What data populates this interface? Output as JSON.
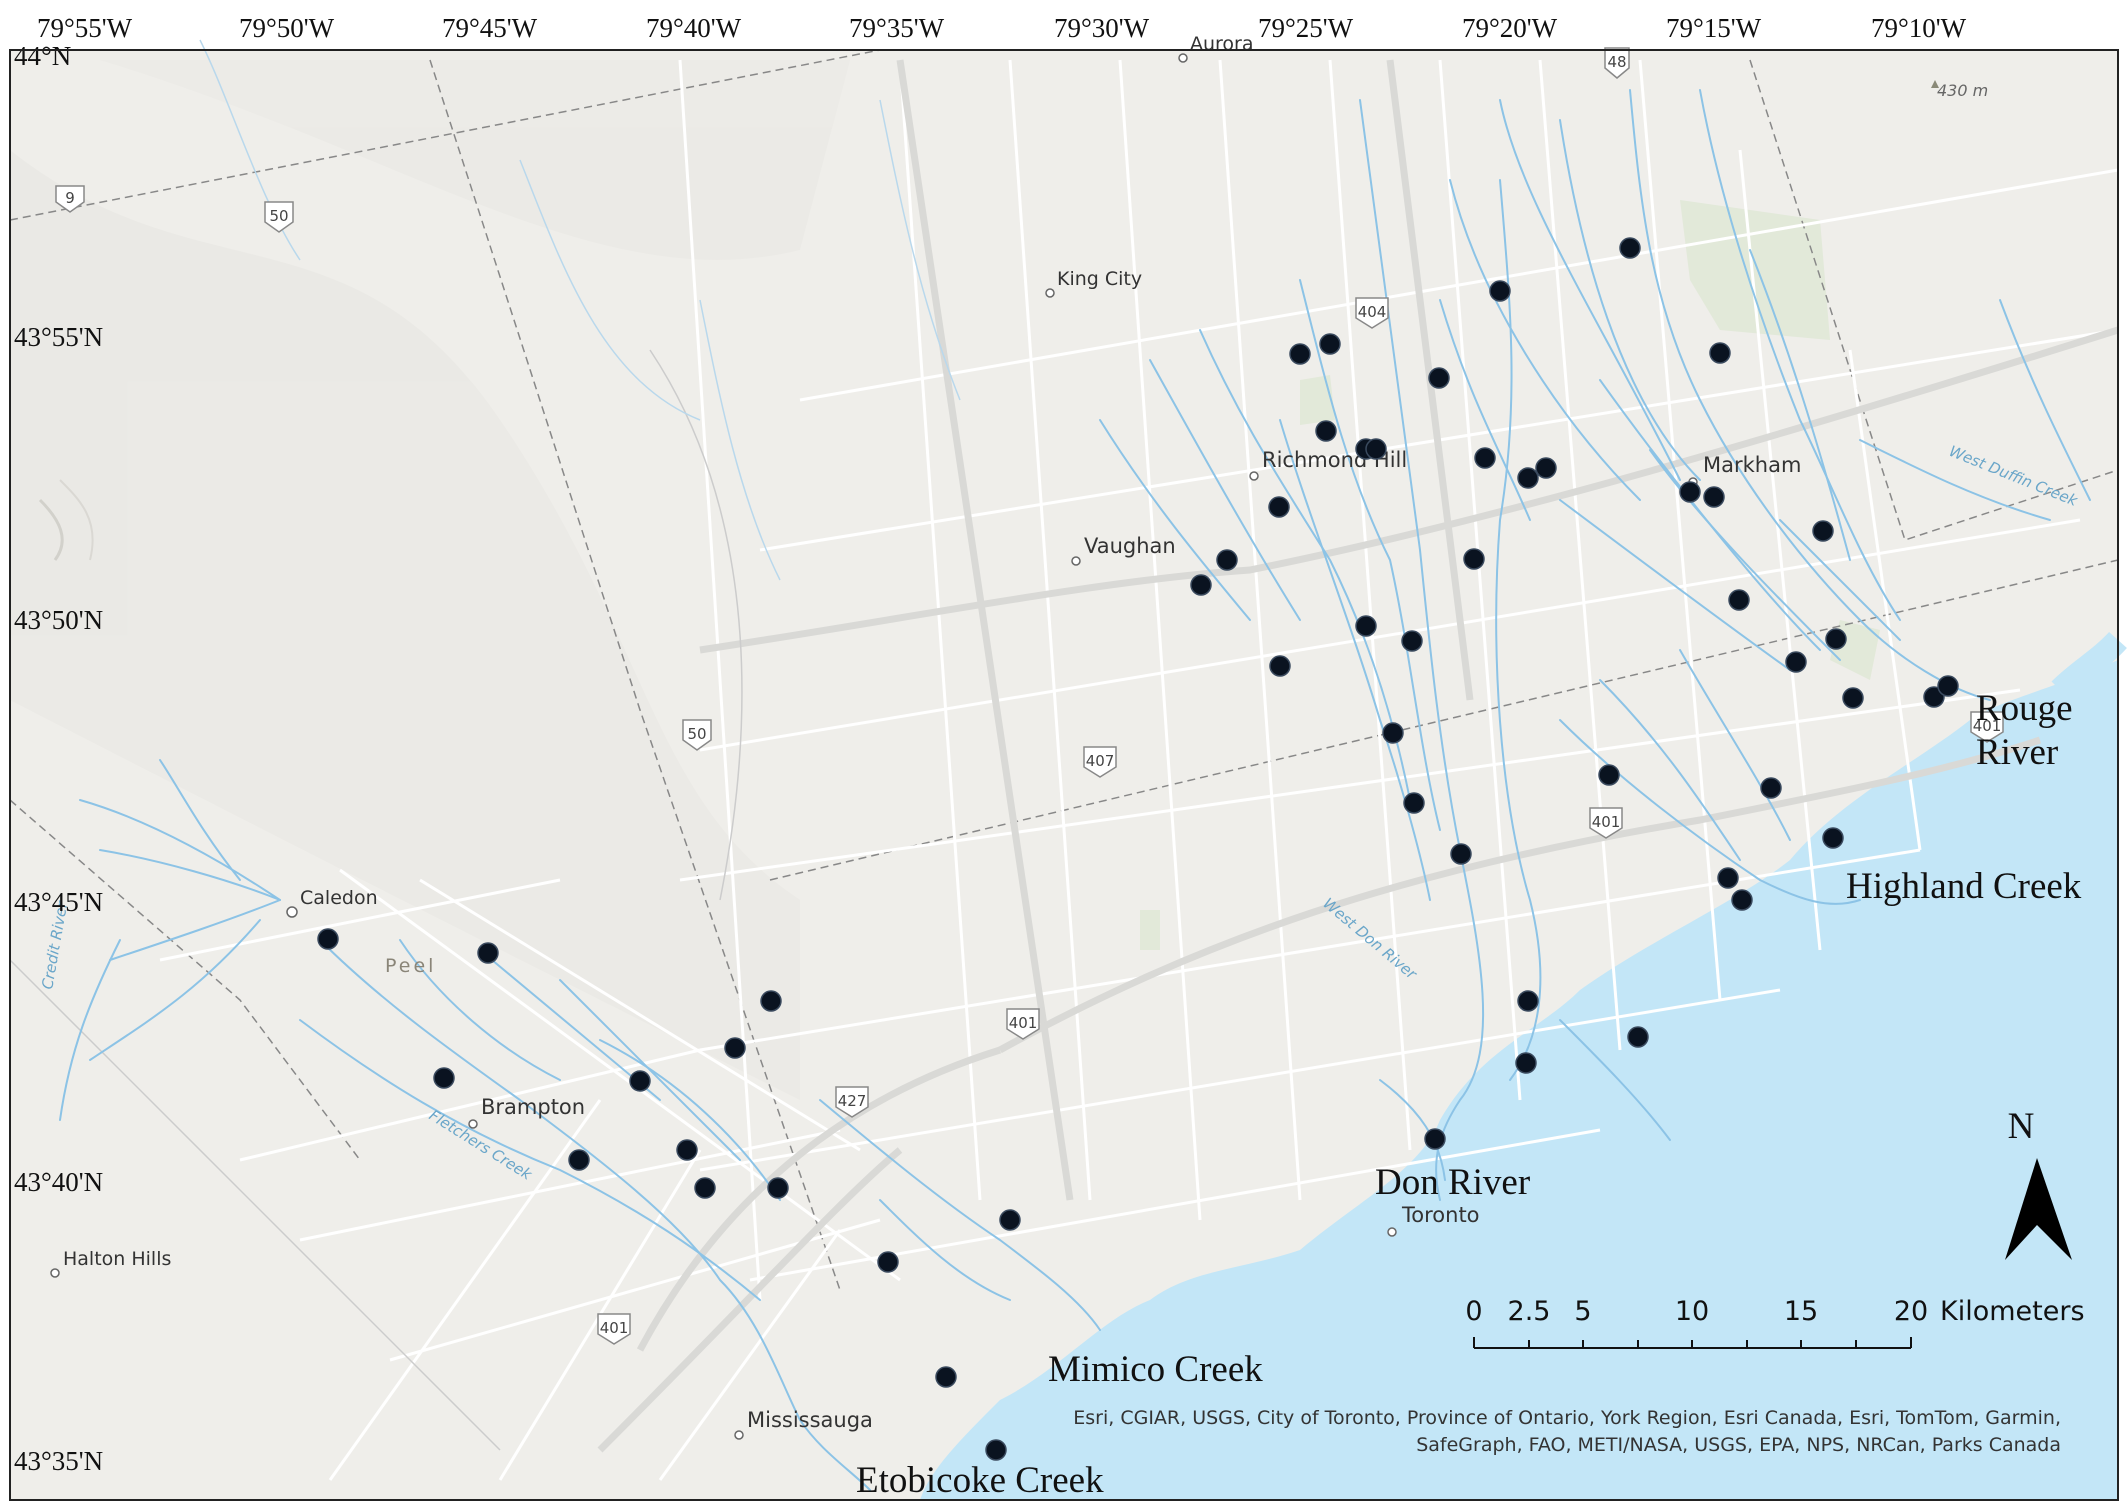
{
  "longitude_labels": [
    "79°55'W",
    "79°50'W",
    "79°45'W",
    "79°40'W",
    "79°35'W",
    "79°30'W",
    "79°25'W",
    "79°20'W",
    "79°15'W",
    "79°10'W"
  ],
  "latitude_labels": [
    "44°N",
    "43°55'N",
    "43°50'N",
    "43°45'N",
    "43°40'N",
    "43°35'N"
  ],
  "places": [
    "Aurora",
    "King City",
    "Richmond Hill",
    "Vaughan",
    "Markham",
    "Caledon",
    "Brampton",
    "Toronto",
    "Halton Hills",
    "Mississauga"
  ],
  "region_label": "Peel",
  "elevation_label": "430 m",
  "water_features": [
    "West Duffin Creek",
    "West Don River",
    "Credit River",
    "Fletchers Creek"
  ],
  "river_labels": {
    "rouge_line1": "Rouge",
    "rouge_line2": "River",
    "highland": "Highland Creek",
    "don": "Don River",
    "mimico": "Mimico Creek",
    "etobicoke": "Etobicoke Creek"
  },
  "highway_shields": [
    "48",
    "9",
    "50",
    "404",
    "50",
    "407",
    "401",
    "401",
    "427",
    "401",
    "401"
  ],
  "north_arrow_label": "N",
  "scale_bar": {
    "ticks": [
      "0",
      "2.5",
      "5",
      "10",
      "15",
      "20"
    ],
    "unit": "Kilometers"
  },
  "attribution": {
    "line1": "Esri, CGIAR, USGS, City of Toronto, Province of Ontario, York Region, Esri Canada, Esri, TomTom, Garmin,",
    "line2": "SafeGraph, FAO, METI/NASA, USGS, EPA, NPS, NRCan, Parks Canada"
  },
  "sampling_site_count": 56,
  "colors": {
    "land": "#efeeea",
    "lake": "#c3e6f7",
    "stream": "#8cc3e6",
    "road": "#ffffff",
    "site": "#0a1320",
    "frame": "#222222"
  }
}
